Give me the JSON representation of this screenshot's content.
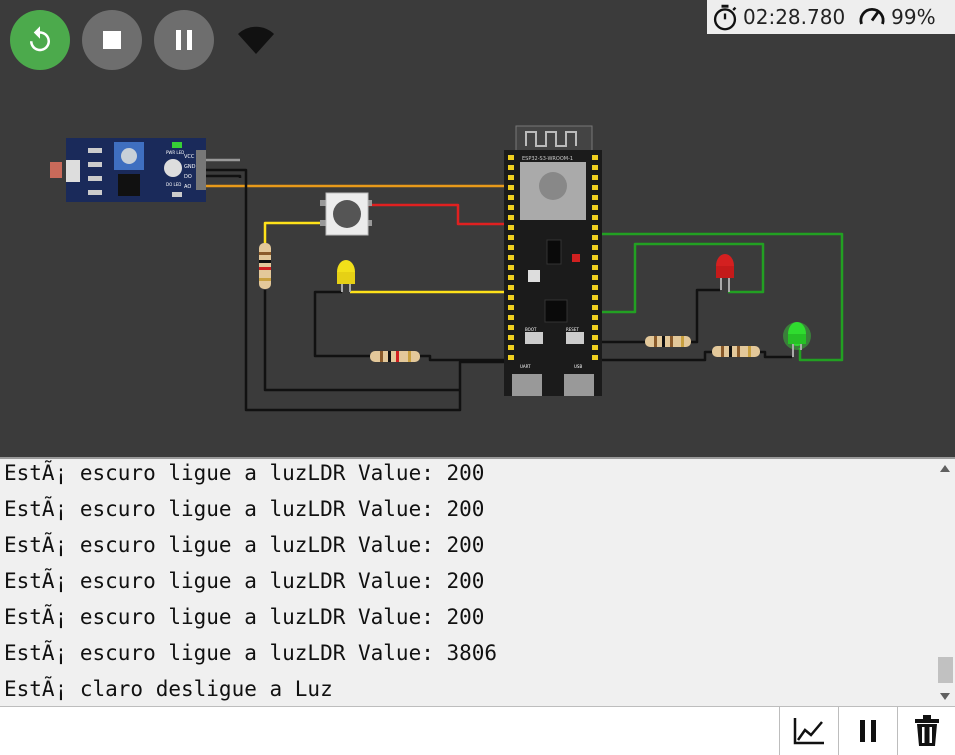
{
  "toolbar": {
    "restart_label": "restart",
    "stop_label": "stop",
    "pause_label": "pause",
    "wifi_icon": "wifi-icon"
  },
  "status": {
    "timer": "02:28.780",
    "speed": "99%"
  },
  "circuit": {
    "esp32_label": "ESP32-S3-WROOM-1",
    "ldr_module_labels": [
      "PWR LED",
      "DO LED",
      "VCC",
      "GND",
      "DO",
      "AO"
    ],
    "esp_buttons": [
      "BOOT",
      "RESET"
    ],
    "usb_labels": [
      "UART",
      "USB"
    ],
    "led_colors": {
      "yellow": "#f2e01a",
      "red": "#d42020",
      "green": "#2fdc2f"
    },
    "wire_colors": {
      "orange": "#e89a1a",
      "red": "#e02020",
      "yellow": "#ffe21a",
      "green": "#22a022",
      "black": "#111111"
    }
  },
  "serial_monitor": {
    "lines": [
      "EstÃ¡ escuro ligue a luzLDR Value: 200",
      "EstÃ¡ escuro ligue a luzLDR Value: 200",
      "EstÃ¡ escuro ligue a luzLDR Value: 200",
      "EstÃ¡ escuro ligue a luzLDR Value: 200",
      "EstÃ¡ escuro ligue a luzLDR Value: 200",
      "EstÃ¡ escuro ligue a luzLDR Value: 3806",
      "EstÃ¡ claro desligue a Luz"
    ]
  },
  "bottom_bar": {
    "input_value": "",
    "plotter_icon": "chart-icon",
    "pause_icon": "pause-icon",
    "clear_icon": "trash-icon"
  }
}
